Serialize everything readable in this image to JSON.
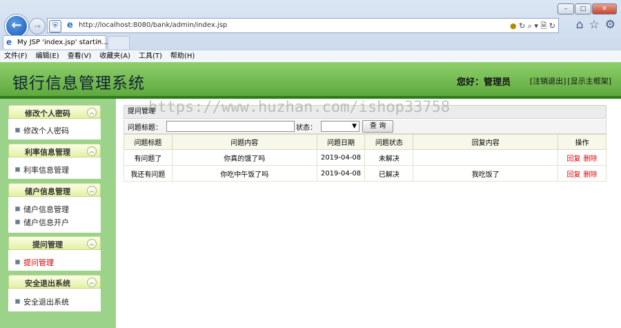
{
  "browser": {
    "url": "http://localhost:8080/bank/admin/index.jsp",
    "tab_title": "My JSP 'index.jsp' startin...",
    "tab_close": "×",
    "address_tools": "↻ ⌕ ▾ 🗎 ↻",
    "menu": [
      "文件(F)",
      "编辑(E)",
      "查看(V)",
      "收藏夹(A)",
      "工具(T)",
      "帮助(H)"
    ]
  },
  "header": {
    "title": "银行信息管理系统",
    "greeting": "您好：管理员",
    "logout": "[注销退出]",
    "show_main": "[显示主框架]",
    "bg_color": "#6fb84a"
  },
  "sidebar": {
    "groups": [
      {
        "title": "修改个人密码",
        "items": [
          "修改个人密码"
        ]
      },
      {
        "title": "利率信息管理",
        "items": [
          "利率信息管理"
        ]
      },
      {
        "title": "储户信息管理",
        "items": [
          "储户信息管理",
          "储户信息开户"
        ]
      },
      {
        "title": "提问管理",
        "items": [
          "提问管理"
        ]
      },
      {
        "title": "安全退出系统",
        "items": [
          "安全退出系统"
        ]
      }
    ],
    "active_item": "提问管理"
  },
  "content": {
    "panel_title": "提问管理",
    "search": {
      "title_label": "问题标题：",
      "title_value": "",
      "status_label": "状态：",
      "status_value": "",
      "query_button": "查 询"
    },
    "table": {
      "headers": [
        "问题标题",
        "问题内容",
        "问题日期",
        "问题状态",
        "回复内容",
        "操作"
      ],
      "rows": [
        {
          "title": "有问题了",
          "content": "你真的饿了吗",
          "date": "2019-04-08",
          "status": "未解决",
          "reply": ""
        },
        {
          "title": "我还有问题",
          "content": "你吃中午饭了吗",
          "date": "2019-04-08",
          "status": "已解决",
          "reply": "我吃饭了"
        }
      ],
      "op_reply": "回复",
      "op_delete": "删除"
    }
  },
  "watermark": "https://www.huzhan.com/ishop33758"
}
